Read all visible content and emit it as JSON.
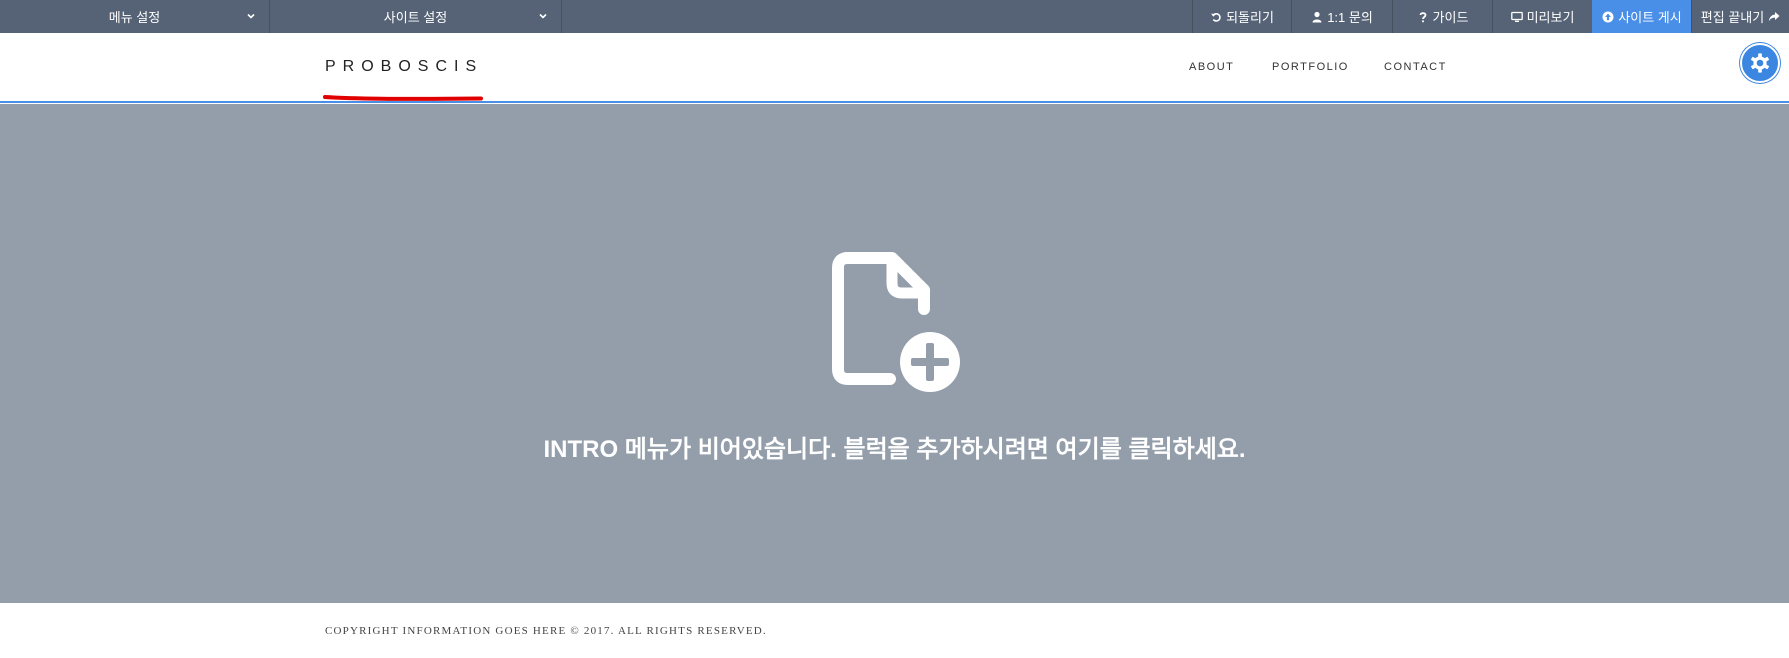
{
  "toolbar": {
    "menu_settings": "메뉴 설정",
    "site_settings": "사이트 설정",
    "undo": "되돌리기",
    "inquiry": "1:1 문의",
    "guide": "가이드",
    "preview": "미리보기",
    "publish": "사이트 게시",
    "finish_editing": "편집 끝내기",
    "publish_color": "#4a8fe7",
    "bar_color": "#566376"
  },
  "header": {
    "logo": "PROBOSCIS",
    "logo_underline_color": "#e00000",
    "nav": [
      "ABOUT",
      "PORTFOLIO",
      "CONTACT"
    ],
    "accent_color": "#4a8fe7",
    "settings_icon": "gear-icon"
  },
  "intro": {
    "icon": "add-document-icon",
    "message": "INTRO 메뉴가 비어있습니다. 블럭을 추가하시려면 여기를 클릭하세요.",
    "background": "#949eab"
  },
  "footer": {
    "copyright": "COPYRIGHT INFORMATION GOES HERE © 2017. ALL RIGHTS RESERVED."
  }
}
